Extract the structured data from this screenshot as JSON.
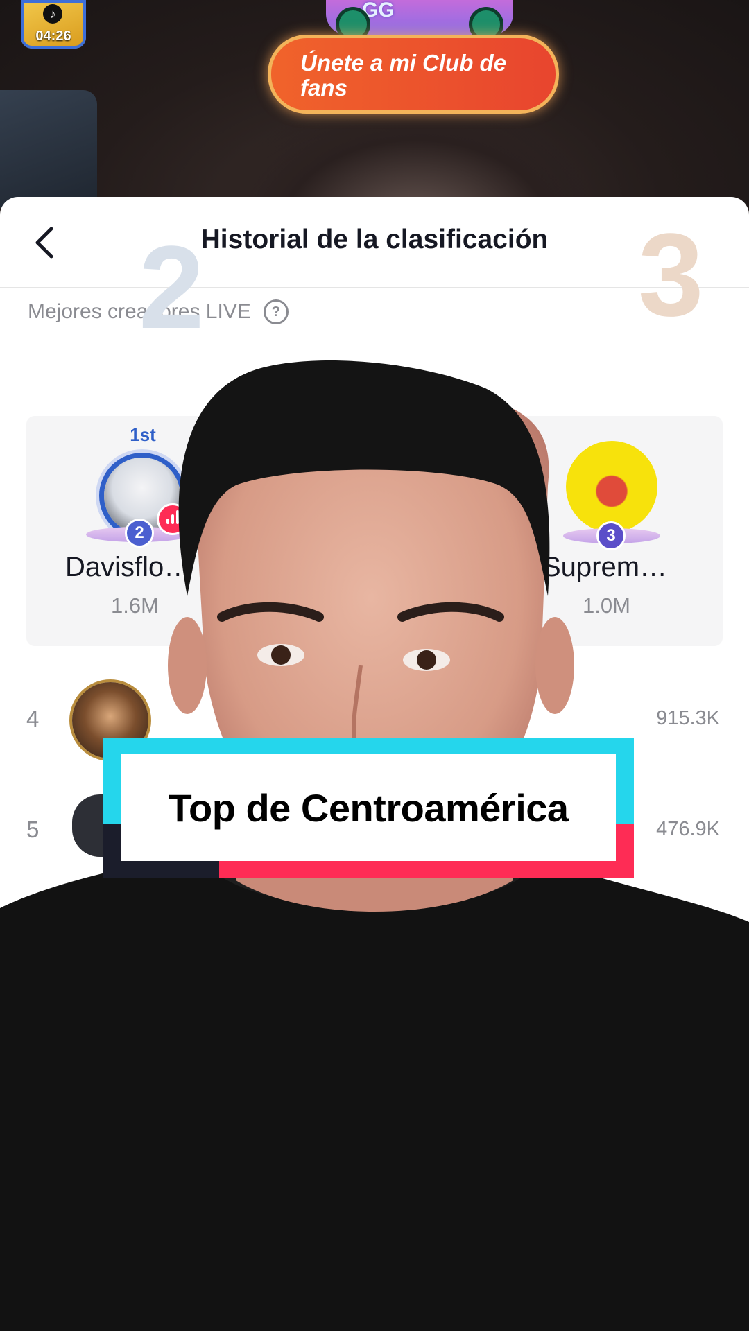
{
  "stream": {
    "timer": "04:26",
    "gift_label": "GG",
    "club_button": "Únete a mi Club de fans"
  },
  "sheet": {
    "title": "Historial de la clasificación",
    "section_label": "Mejores creadores LIVE"
  },
  "podium": {
    "second": {
      "rank": "2",
      "crown": "1st",
      "level": "2",
      "name": "Davisflo…",
      "score": "1.6M"
    },
    "third": {
      "rank": "3",
      "level": "3",
      "name": "Suprem…",
      "score": "1.0M"
    }
  },
  "list": [
    {
      "rank": "4",
      "score": "915.3K"
    },
    {
      "rank": "5",
      "score": "476.9K"
    }
  ],
  "caption": {
    "text": "Top de Centroamérica"
  },
  "colors": {
    "accent_pink": "#fe2c55",
    "accent_cyan": "#25d6ec",
    "club_orange": "#f0632b"
  }
}
